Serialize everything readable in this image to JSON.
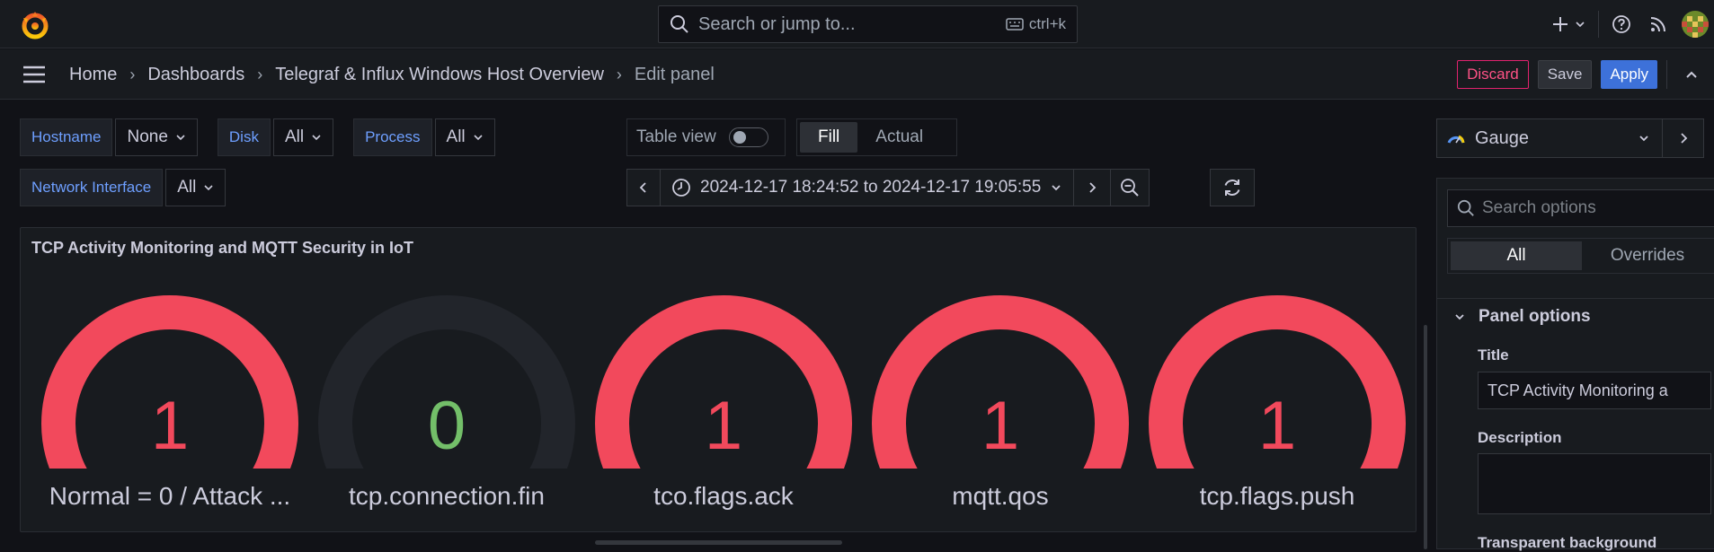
{
  "topbar": {
    "search_placeholder": "Search or jump to...",
    "shortcut": "ctrl+k"
  },
  "breadcrumb": [
    "Home",
    "Dashboards",
    "Telegraf & Influx Windows Host Overview",
    "Edit panel"
  ],
  "actions": {
    "discard": "Discard",
    "save": "Save",
    "apply": "Apply"
  },
  "variables": [
    {
      "label": "Hostname",
      "value": "None"
    },
    {
      "label": "Disk",
      "value": "All"
    },
    {
      "label": "Process",
      "value": "All"
    },
    {
      "label": "Network Interface",
      "value": "All"
    }
  ],
  "toolbar": {
    "table_view": "Table view",
    "table_view_on": false,
    "fill": "Fill",
    "actual": "Actual",
    "active_mode": "Fill",
    "time_range": "2024-12-17 18:24:52 to 2024-12-17 19:05:55"
  },
  "panel": {
    "title": "TCP Activity Monitoring and MQTT Security in IoT",
    "gauges": [
      {
        "label": "Normal = 0 / Attack ...",
        "value": "1",
        "color": "#f2495c"
      },
      {
        "label": "tcp.connection.fin",
        "value": "0",
        "color": "#73bf69"
      },
      {
        "label": "tco.flags.ack",
        "value": "1",
        "color": "#f2495c"
      },
      {
        "label": "mqtt.qos",
        "value": "1",
        "color": "#f2495c"
      },
      {
        "label": "tcp.flags.push",
        "value": "1",
        "color": "#f2495c"
      }
    ]
  },
  "options": {
    "visualization": "Gauge",
    "search_placeholder": "Search options",
    "tab_all": "All",
    "tab_overrides": "Overrides",
    "section": "Panel options",
    "title_label": "Title",
    "title_value": "TCP Activity Monitoring a",
    "description_label": "Description",
    "transparent_label": "Transparent background"
  },
  "colors": {
    "accent": "#3d71d9",
    "danger": "#f2495c",
    "ok": "#73bf69",
    "track": "#22252b",
    "variable_label": "#6e9fff"
  }
}
